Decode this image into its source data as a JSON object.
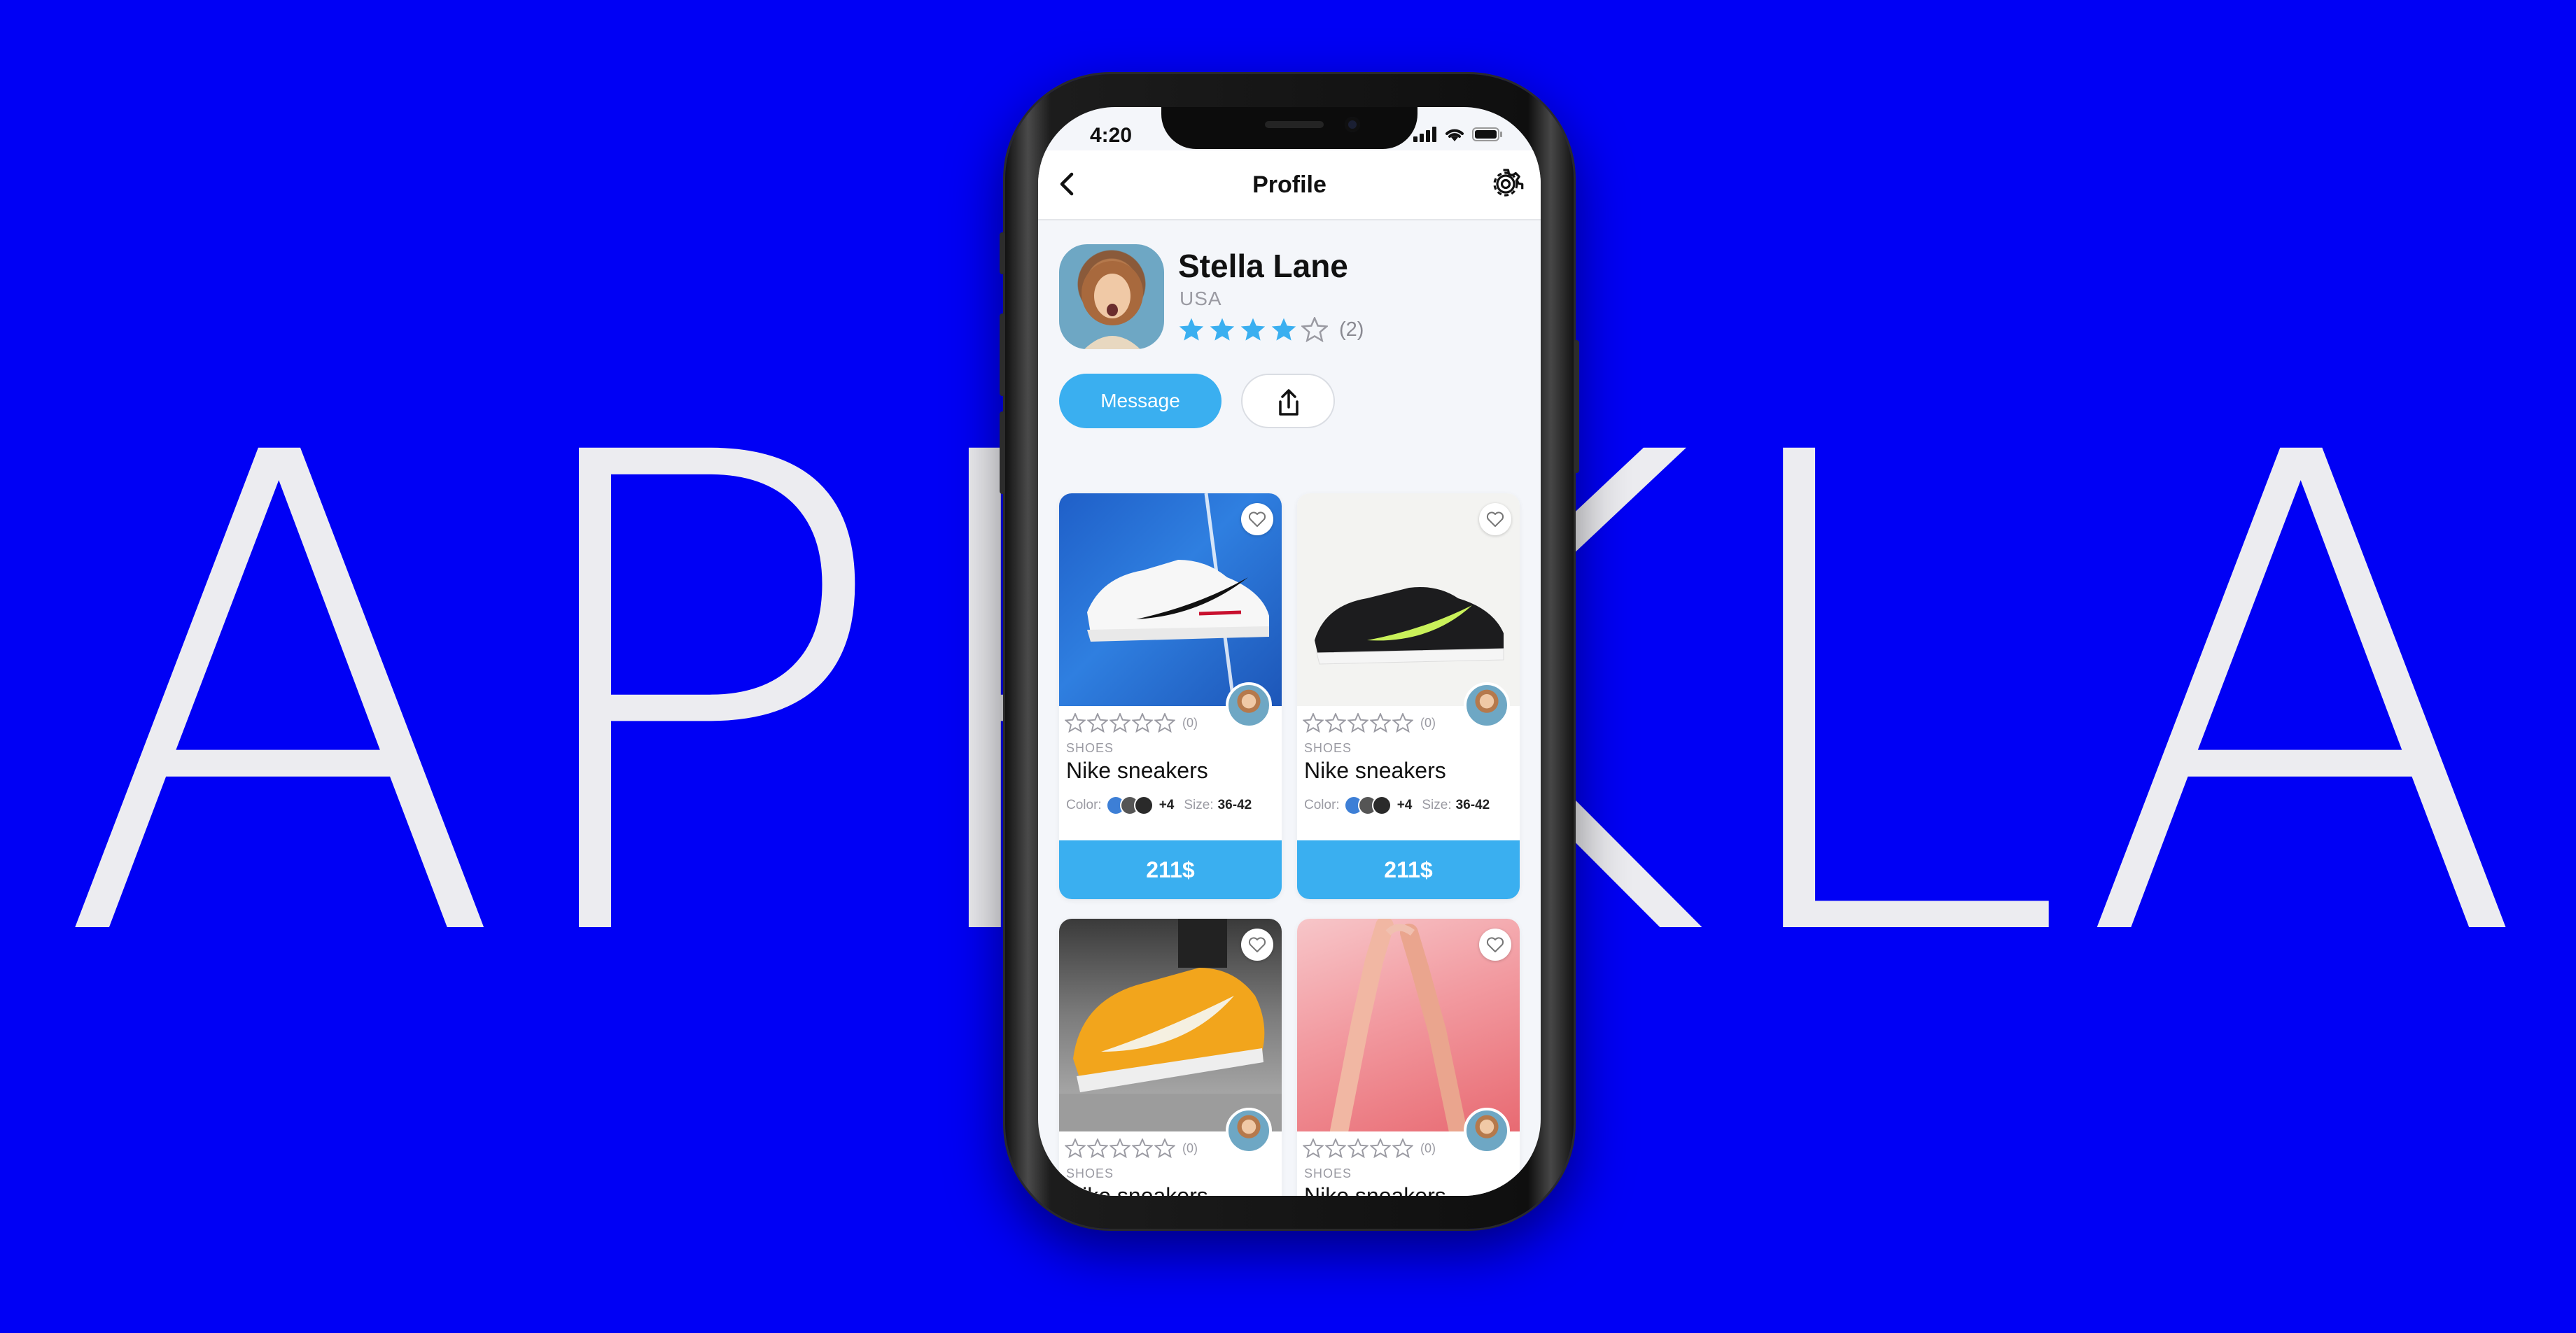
{
  "background": {
    "word": "APPKLA",
    "color": "#0000f5",
    "text_color": "#ececf0"
  },
  "status_bar": {
    "time": "4:20",
    "icons": [
      "signal-icon",
      "wifi-icon",
      "battery-icon"
    ]
  },
  "header": {
    "title": "Profile",
    "back_icon": "chevron-left-icon",
    "settings_icon": "gear-icon"
  },
  "profile": {
    "name": "Stella Lane",
    "country": "USA",
    "rating": 4,
    "rating_max": 5,
    "review_count": "(2)",
    "message_button": "Message",
    "share_icon": "share-icon",
    "accent_color": "#3aaff0"
  },
  "products": [
    {
      "category": "SHOES",
      "name": "Nike sneakers",
      "rating_count": "(0)",
      "color_label": "Color:",
      "extra_colors": "+4",
      "size_label": "Size:",
      "size": "36-42",
      "price": "211$"
    },
    {
      "category": "SHOES",
      "name": "Nike sneakers",
      "rating_count": "(0)",
      "color_label": "Color:",
      "extra_colors": "+4",
      "size_label": "Size:",
      "size": "36-42",
      "price": "211$"
    },
    {
      "category": "SHOES",
      "name": "Nike sneakers",
      "rating_count": "(0)"
    },
    {
      "category": "SHOES",
      "name": "Nike sneakers",
      "rating_count": "(0)"
    }
  ]
}
